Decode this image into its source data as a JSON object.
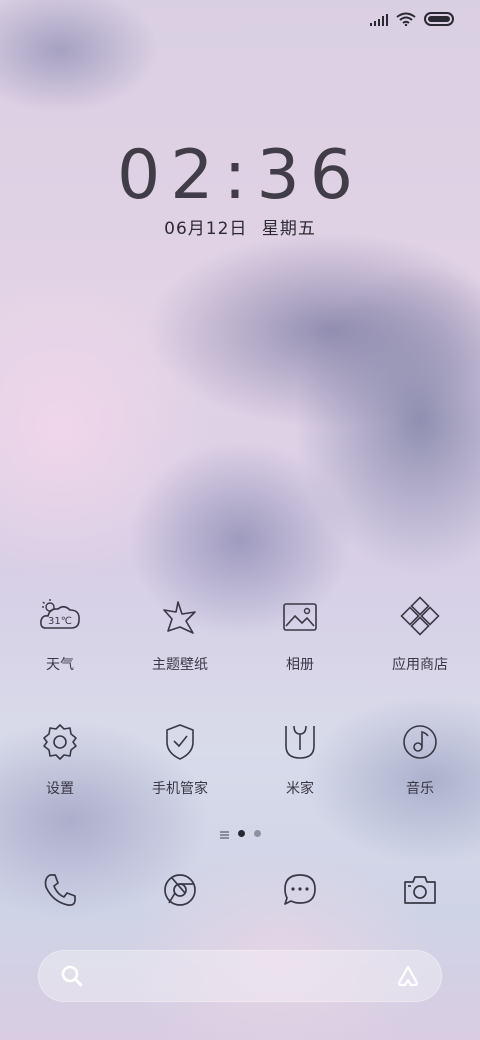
{
  "status_bar": {
    "icons": [
      "signal-icon",
      "wifi-icon",
      "battery-icon"
    ]
  },
  "clock": {
    "time": "02:36",
    "date": "06月12日",
    "weekday": "星期五"
  },
  "apps_row1": [
    {
      "label": "天气",
      "icon": "weather-icon",
      "temp": "31℃"
    },
    {
      "label": "主题壁纸",
      "icon": "theme-icon"
    },
    {
      "label": "相册",
      "icon": "gallery-icon"
    },
    {
      "label": "应用商店",
      "icon": "app-store-icon"
    }
  ],
  "apps_row2": [
    {
      "label": "设置",
      "icon": "settings-icon"
    },
    {
      "label": "手机管家",
      "icon": "security-icon"
    },
    {
      "label": "米家",
      "icon": "mi-home-icon"
    },
    {
      "label": "音乐",
      "icon": "music-icon"
    }
  ],
  "page_indicator": {
    "pages": 2,
    "current": 1
  },
  "dock": [
    {
      "icon": "phone-icon"
    },
    {
      "icon": "browser-icon"
    },
    {
      "icon": "messages-icon"
    },
    {
      "icon": "camera-icon"
    }
  ],
  "search_bar": {
    "icons": [
      "search-icon",
      "assistant-icon"
    ]
  },
  "colors": {
    "icon_stroke": "#3a3846",
    "text": "#3a3846"
  }
}
